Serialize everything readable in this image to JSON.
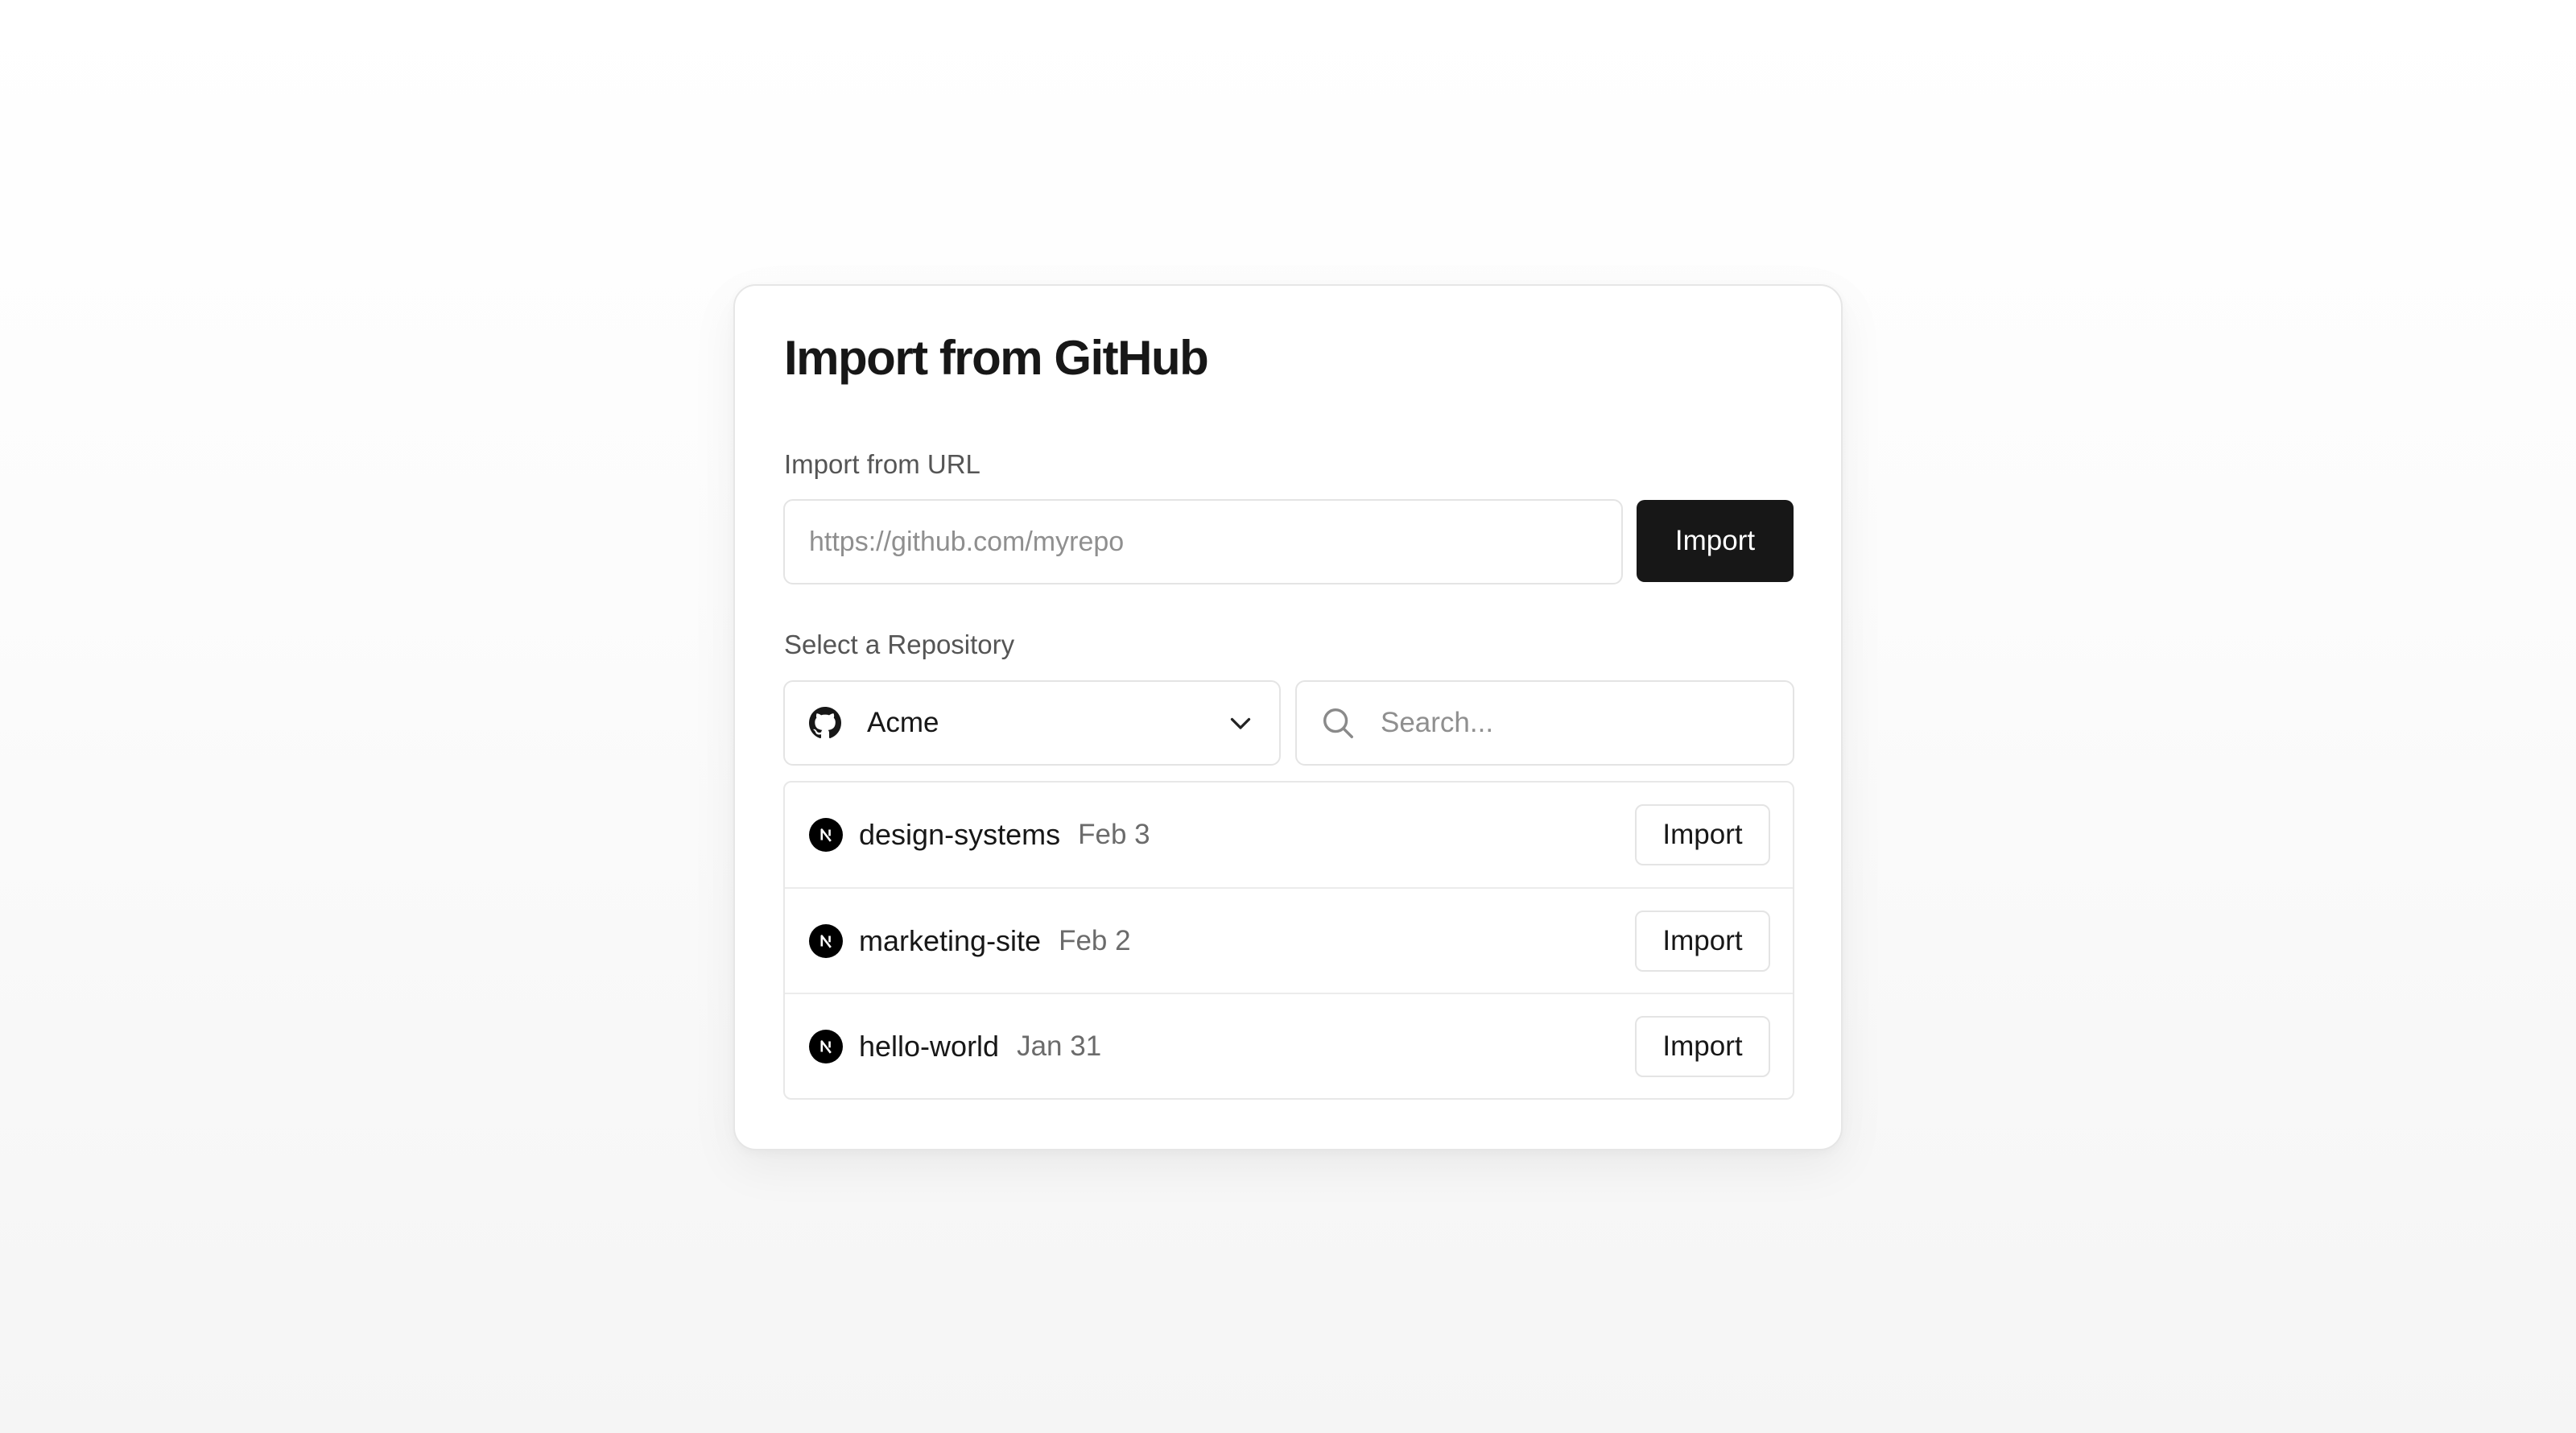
{
  "dialog": {
    "title": "Import from GitHub"
  },
  "url_import": {
    "label": "Import from URL",
    "value": "",
    "placeholder": "https://github.com/myrepo",
    "button_label": "Import"
  },
  "repository": {
    "label": "Select a Repository",
    "account": {
      "selected": "Acme",
      "icon": "github-icon"
    },
    "search": {
      "value": "",
      "placeholder": "Search..."
    },
    "items": [
      {
        "name": "design-systems",
        "date": "Feb 3",
        "icon": "nextjs-icon",
        "button_label": "Import"
      },
      {
        "name": "marketing-site",
        "date": "Feb 2",
        "icon": "nextjs-icon",
        "button_label": "Import"
      },
      {
        "name": "hello-world",
        "date": "Jan 31",
        "icon": "nextjs-icon",
        "button_label": "Import"
      }
    ]
  },
  "colors": {
    "primary_button_bg": "#171717",
    "primary_button_text": "#ffffff",
    "border": "#e4e4e4",
    "muted_text": "#6b6b6b"
  }
}
